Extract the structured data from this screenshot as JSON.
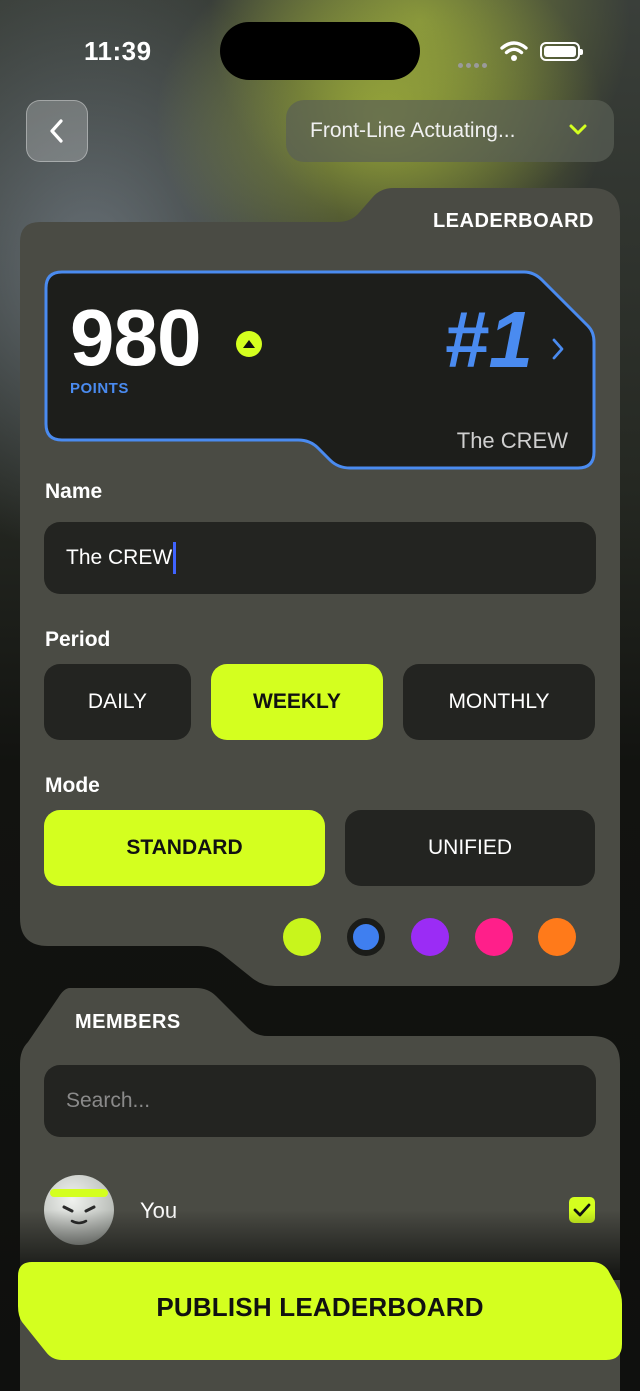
{
  "status_bar": {
    "time": "11:39"
  },
  "header": {
    "selector_value": "Front-Line Actuating..."
  },
  "leaderboard": {
    "section_title": "LEADERBOARD",
    "score": "980",
    "score_unit": "POINTS",
    "rank": "#1",
    "team_name": "The CREW",
    "name_label": "Name",
    "name_value": "The CREW",
    "period_label": "Period",
    "period_options": [
      "DAILY",
      "WEEKLY",
      "MONTHLY"
    ],
    "period_selected": "WEEKLY",
    "mode_label": "Mode",
    "mode_options": [
      "STANDARD",
      "UNIFIED"
    ],
    "mode_selected": "STANDARD",
    "colors": [
      "#c8f51c",
      "#3f7ff0",
      "#9b2cf5",
      "#ff1f8a",
      "#ff7a1a"
    ],
    "selected_color": "#3f7ff0"
  },
  "members": {
    "section_title": "MEMBERS",
    "search_placeholder": "Search...",
    "list": [
      {
        "name": "You",
        "checked": true
      }
    ]
  },
  "footer": {
    "publish_label": "PUBLISH LEADERBOARD"
  },
  "theme": {
    "accent": "#d4ff1f",
    "blue": "#4a8bf0",
    "card": "#4a4b44",
    "field": "#232421"
  }
}
